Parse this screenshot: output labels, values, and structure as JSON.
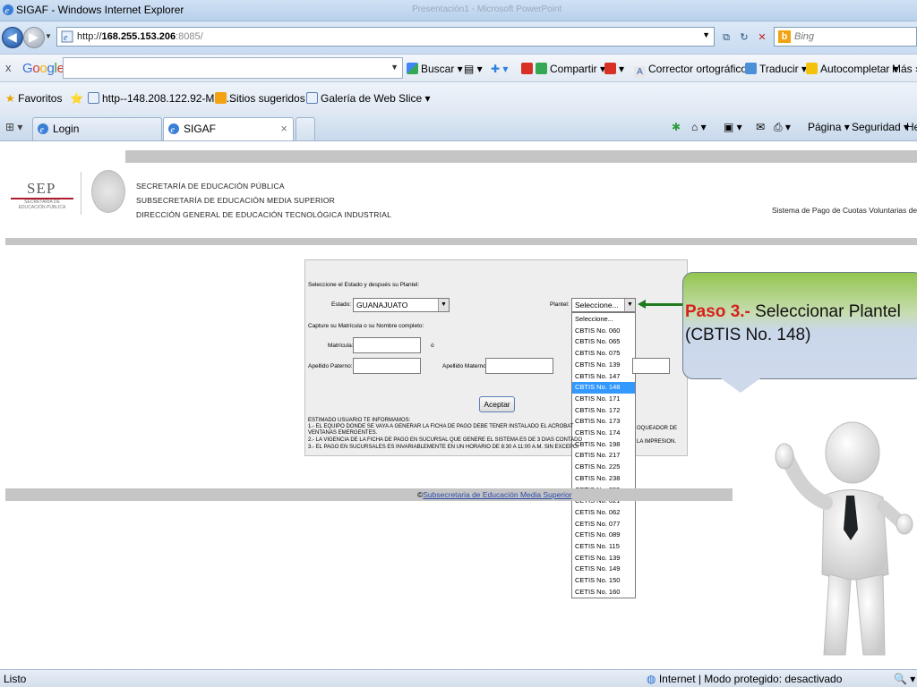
{
  "window": {
    "title": "SIGAF - Windows Internet Explorer",
    "ghost_title_1": "Presentación1 - Microsoft PowerPoint"
  },
  "address": {
    "url_prefix": "http://",
    "url_host": "168.255.153.206",
    "url_rest": ":8085/",
    "search_placeholder": "Bing"
  },
  "google_bar": {
    "close": "x",
    "logo": "Google",
    "items": [
      "Buscar ▾",
      "Compartir ▾",
      "Corrector ortográfico ▾",
      "Traducir ▾",
      "Autocompletar ▾",
      "Más »"
    ]
  },
  "favorites_bar": {
    "favorites": "Favoritos",
    "items": [
      "http--148.208.122.92-Men...",
      "Sitios sugeridos ▾",
      "Galería de Web Slice ▾"
    ]
  },
  "tabs": [
    {
      "label": "Login"
    },
    {
      "label": "SIGAF"
    }
  ],
  "commands": {
    "page": "Página ▾",
    "security": "Seguridad ▾",
    "help": "He"
  },
  "header": {
    "logo_text": "SEP",
    "logo_sub": "SECRETARÍA DE EDUCACIÓN PÚBLICA",
    "line1": "SECRETARÍA DE EDUCACIÓN PÚBLICA",
    "line2": "SUBSECRETARÍA DE EDUCACIÓN MEDIA SUPERIOR",
    "line3": "DIRECCIÓN GENERAL DE EDUCACIÓN TECNOLÓGICA INDUSTRIAL",
    "system_title": "Sistema de Pago de Cuotas Voluntarias de Alu"
  },
  "form": {
    "intro": "Seleccione el Estado y después su Plantel:",
    "estado_label": "Estado:",
    "estado_value": "GUANAJUATO",
    "plantel_label": "Plantel:",
    "plantel_value": "Seleccione...",
    "capture_label": "Capture su Matrícula o su Nombre completo:",
    "matricula_label": "Matrícula:",
    "or_label": "ó",
    "apellido_paterno_label": "Apellido Paterno:",
    "apellido_materno_label": "Apellido Materno:",
    "submit_label": "Aceptar",
    "notes": [
      "ESTIMADO USUARIO TE INFORMAMOS:",
      "1.- EL EQUIPO DONDE SE VAYA A GENERAR LA FICHA DE PAGO DEBE TENER INSTALADO EL ACROBAT",
      "VENTANAS EMERGENTES.",
      "2.- LA VIGENCIA DE LA FICHA DE PAGO EN SUCURSAL QUE GENERE EL SISTEMA ES DE 3 DIAS CONTADO",
      "3.- EL PAGO EN SUCURSALES ES INVARIABLEMENTE EN UN HORARIO DE 8:30 A 11:00 A.M. SIN EXCEPCI"
    ],
    "notes_right": [
      "OQUEADOR DE",
      "LA IMPRESION."
    ]
  },
  "plantel_options": [
    "Seleccione...",
    "CBTIS No. 060",
    "CBTIS No. 065",
    "CBTIS No. 075",
    "CBTIS No. 139",
    "CBTIS No. 147",
    "CBTIS No. 148",
    "CBTIS No. 171",
    "CBTIS No. 172",
    "CBTIS No. 173",
    "CBTIS No. 174",
    "CBTIS No. 198",
    "CBTIS No. 217",
    "CBTIS No. 225",
    "CBTIS No. 238",
    "CBTIS No. 255",
    "CETIS No. 021",
    "CETIS No. 062",
    "CETIS No. 077",
    "CETIS No. 089",
    "CETIS No. 115",
    "CETIS No. 139",
    "CETIS No. 149",
    "CETIS No. 150",
    "CETIS No. 160"
  ],
  "plantel_selected_index": 6,
  "footer": {
    "prefix": "©",
    "link": "Subsecretaria de Educación Media Superior"
  },
  "callout": {
    "step": "Paso 3.-",
    "text": "Seleccionar Plantel",
    "detail": "(CBTIS No. 148)"
  },
  "status": {
    "left": "Listo",
    "right": "Internet | Modo protegido: desactivado"
  }
}
